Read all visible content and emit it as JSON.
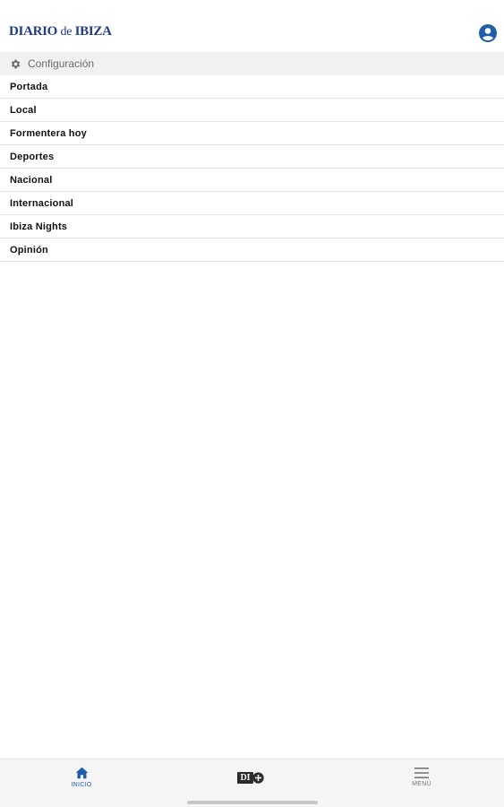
{
  "header": {
    "logo_main": "DIARIO",
    "logo_de": "de",
    "logo_end": "IBIZA",
    "user_icon": "user-circle-icon"
  },
  "config": {
    "label": "Configuración",
    "icon": "gear-icon"
  },
  "menu": {
    "items": [
      {
        "label": "Portada"
      },
      {
        "label": "Local"
      },
      {
        "label": "Formentera hoy"
      },
      {
        "label": "Deportes"
      },
      {
        "label": "Nacional"
      },
      {
        "label": "Internacional"
      },
      {
        "label": "Ibiza Nights"
      },
      {
        "label": "Opinión"
      }
    ]
  },
  "tabbar": {
    "inicio_label": "INICIO",
    "di_label": "DI",
    "menu_label": "MENÚ",
    "active_color": "#1f5fa8",
    "inactive_color": "#777777"
  },
  "colors": {
    "brand_blue": "#1f3a8a",
    "accent_blue": "#1f5fa8"
  }
}
